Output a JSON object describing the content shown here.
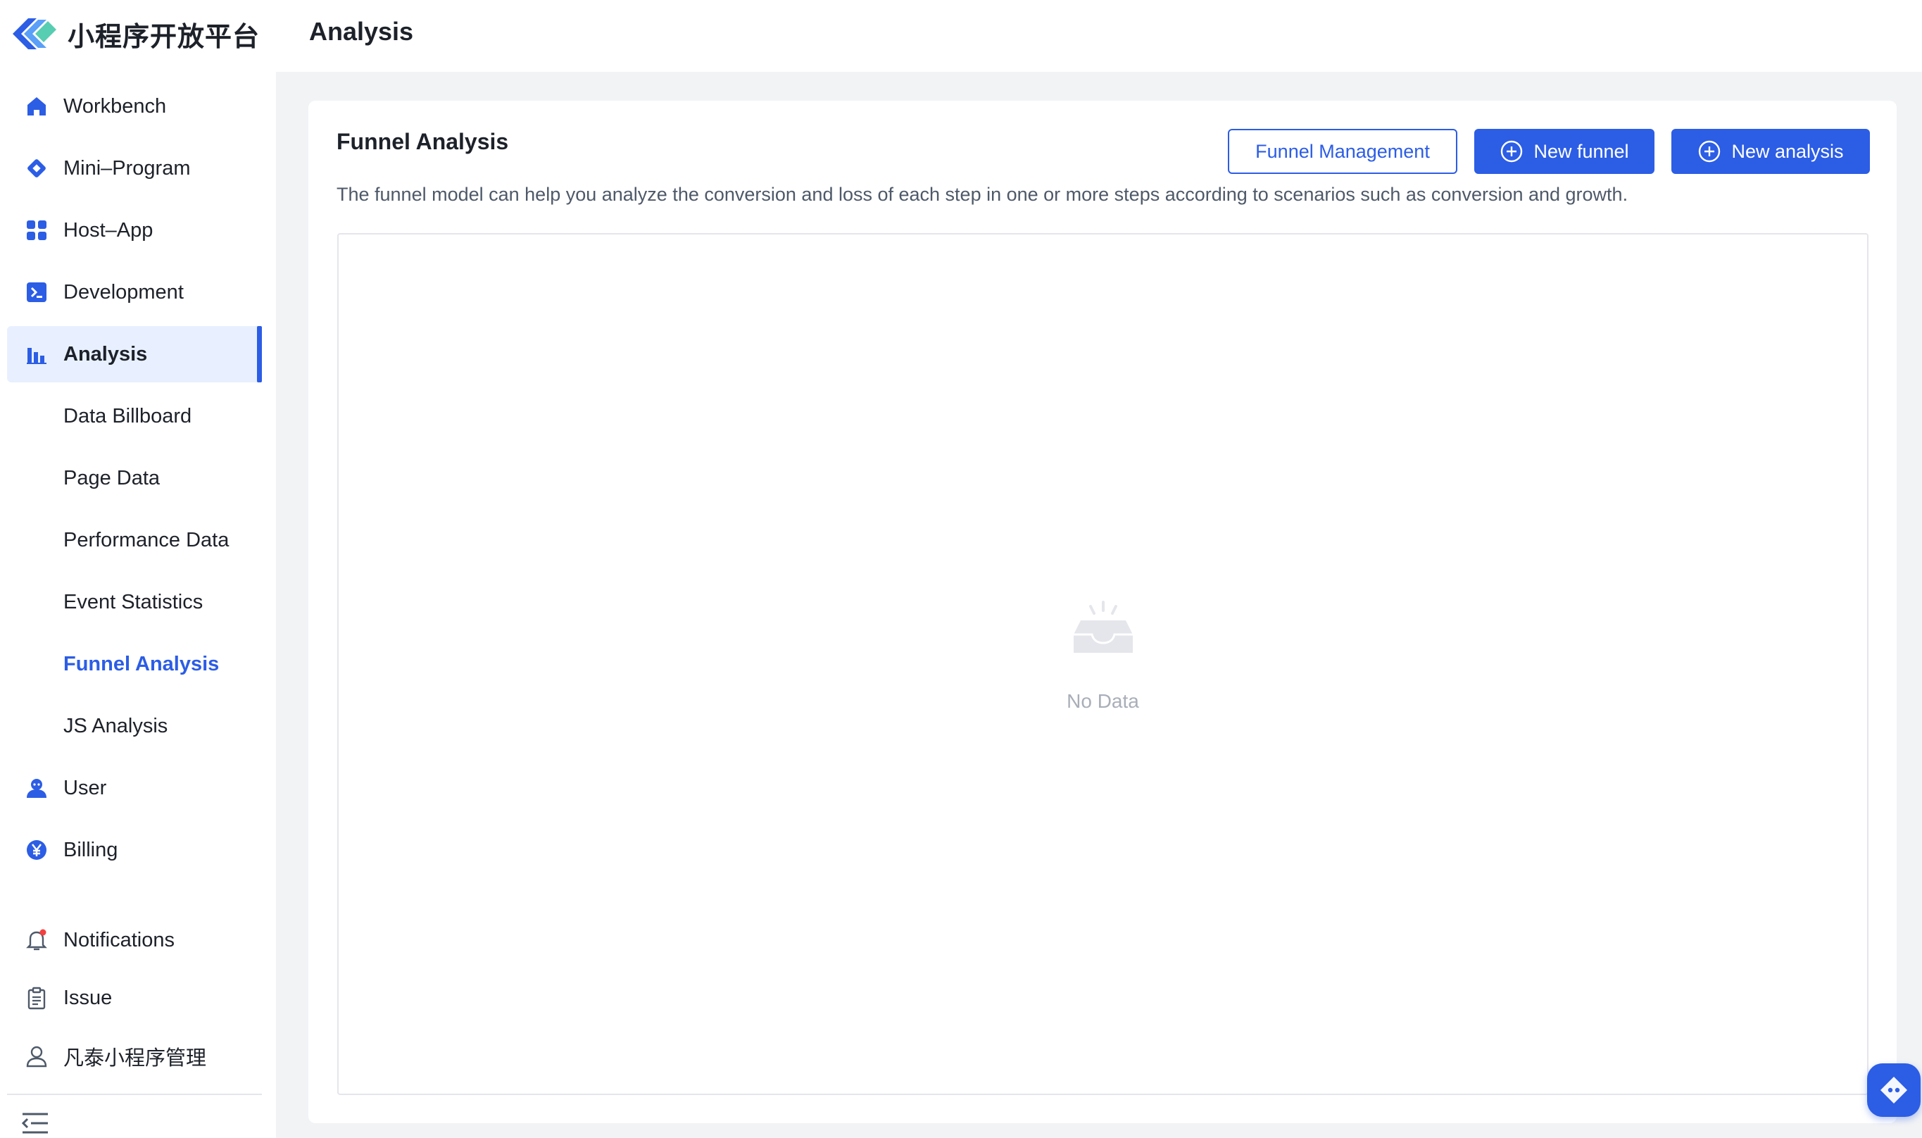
{
  "app": {
    "logo_text": "小程序开放平台",
    "accent_color": "#2c5de5"
  },
  "sidebar": {
    "items": [
      {
        "label": "Workbench",
        "icon": "home-icon"
      },
      {
        "label": "Mini–Program",
        "icon": "diamond-icon"
      },
      {
        "label": "Host–App",
        "icon": "grid-icon"
      },
      {
        "label": "Development",
        "icon": "terminal-icon"
      },
      {
        "label": "Analysis",
        "icon": "bar-chart-icon",
        "active": true
      },
      {
        "label": "Data Billboard"
      },
      {
        "label": "Page Data"
      },
      {
        "label": "Performance Data"
      },
      {
        "label": "Event Statistics"
      },
      {
        "label": "Funnel Analysis",
        "active": true
      },
      {
        "label": "JS Analysis"
      },
      {
        "label": "User",
        "icon": "user-icon"
      },
      {
        "label": "Billing",
        "icon": "yen-coin-icon"
      }
    ],
    "bottom": [
      {
        "label": "Notifications",
        "icon": "bell-icon",
        "has_badge": true
      },
      {
        "label": "Issue",
        "icon": "clipboard-icon"
      },
      {
        "label": "凡泰小程序管理",
        "icon": "person-outline-icon"
      }
    ],
    "collapse_icon": "collapse-menu-icon"
  },
  "header": {
    "title": "Analysis"
  },
  "main": {
    "card_title": "Funnel Analysis",
    "description": "The funnel model can help you analyze the conversion and loss of each step in one or more steps according to scenarios such as conversion and growth.",
    "buttons": {
      "management": "Funnel Management",
      "new_funnel": "New funnel",
      "new_analysis": "New analysis"
    },
    "empty_text": "No Data"
  }
}
